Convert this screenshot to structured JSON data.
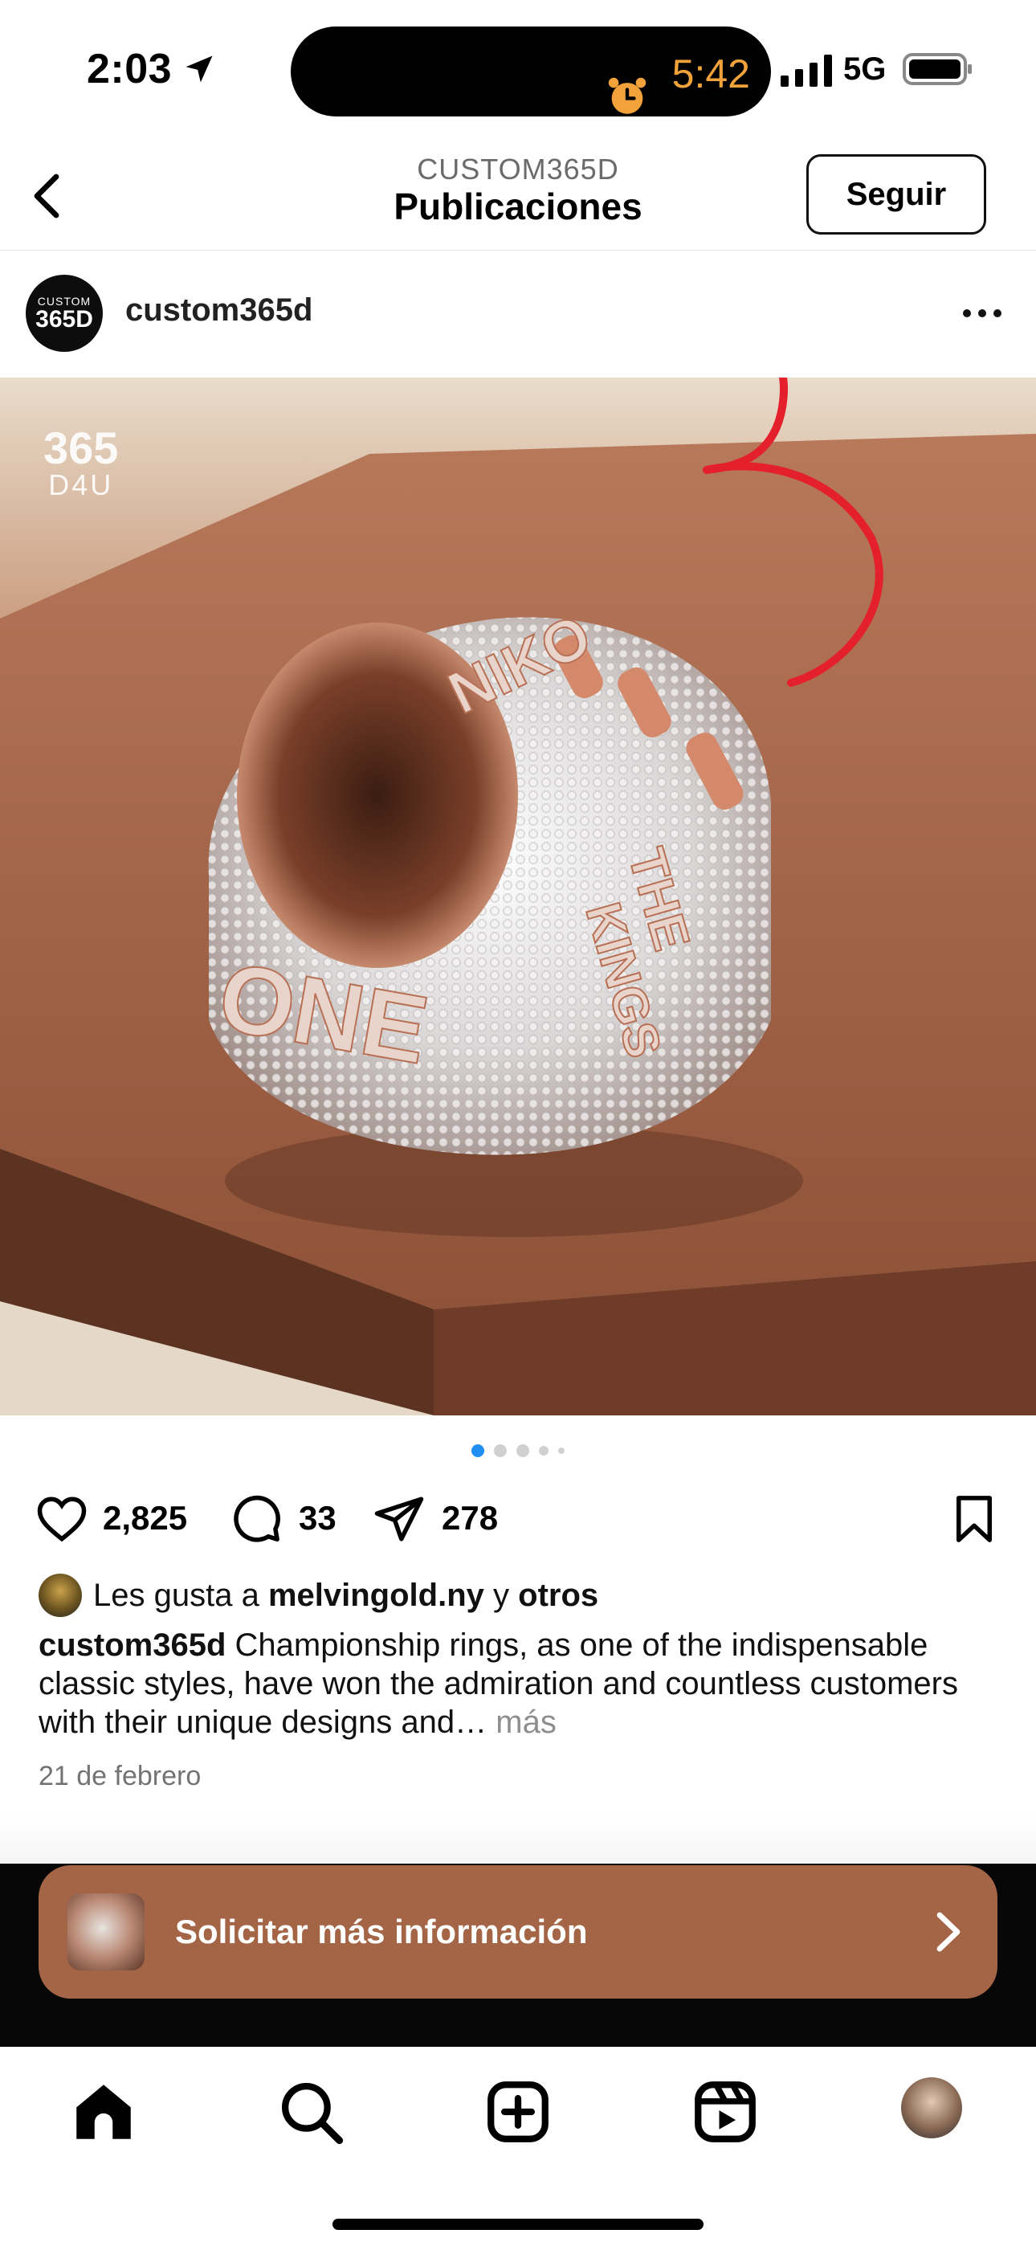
{
  "status_bar": {
    "time": "2:03",
    "timer": "5:42",
    "network": "5G",
    "icons": [
      "location-arrow-icon",
      "alarm-icon",
      "signal-icon",
      "battery-icon"
    ],
    "timer_color": "#f2a23a"
  },
  "nav": {
    "subtitle": "CUSTOM365D",
    "title": "Publicaciones",
    "follow_label": "Seguir",
    "icons": [
      "back-arrow-icon"
    ]
  },
  "post": {
    "username": "custom365d",
    "avatar_text_top": "CUSTOM",
    "avatar_text_main": "365D",
    "icons": [
      "more-options-icon"
    ],
    "image": {
      "watermark_top": "365",
      "watermark_bottom": "D4U",
      "ring_words": [
        "NIKO",
        "THE",
        "KINGS",
        "ONE"
      ],
      "annotation": "3",
      "annotation_color": "#e3202b"
    },
    "carousel": {
      "count": 5,
      "active_index": 0
    },
    "likes_count": "2,825",
    "comments_count": "33",
    "shares_count": "278",
    "action_icons": [
      "heart-icon",
      "comment-icon",
      "share-icon",
      "bookmark-icon"
    ],
    "liked_by_prefix": "Les gusta a",
    "liked_by_user": "melvingold.ny",
    "liked_by_joiner": "y",
    "liked_by_others": "otros",
    "caption_user": "custom365d",
    "caption_text": "Championship rings, as one of the indispensable classic styles, have won the admiration and countless customers with their unique designs and…",
    "caption_more": "más",
    "date": "21 de febrero"
  },
  "cta": {
    "label": "Solicitar más información",
    "color": "#a46546",
    "icons": [
      "chevron-right-icon"
    ]
  },
  "tabbar": {
    "items": [
      "home-icon",
      "search-icon",
      "create-icon",
      "reels-icon",
      "profile-avatar"
    ]
  }
}
